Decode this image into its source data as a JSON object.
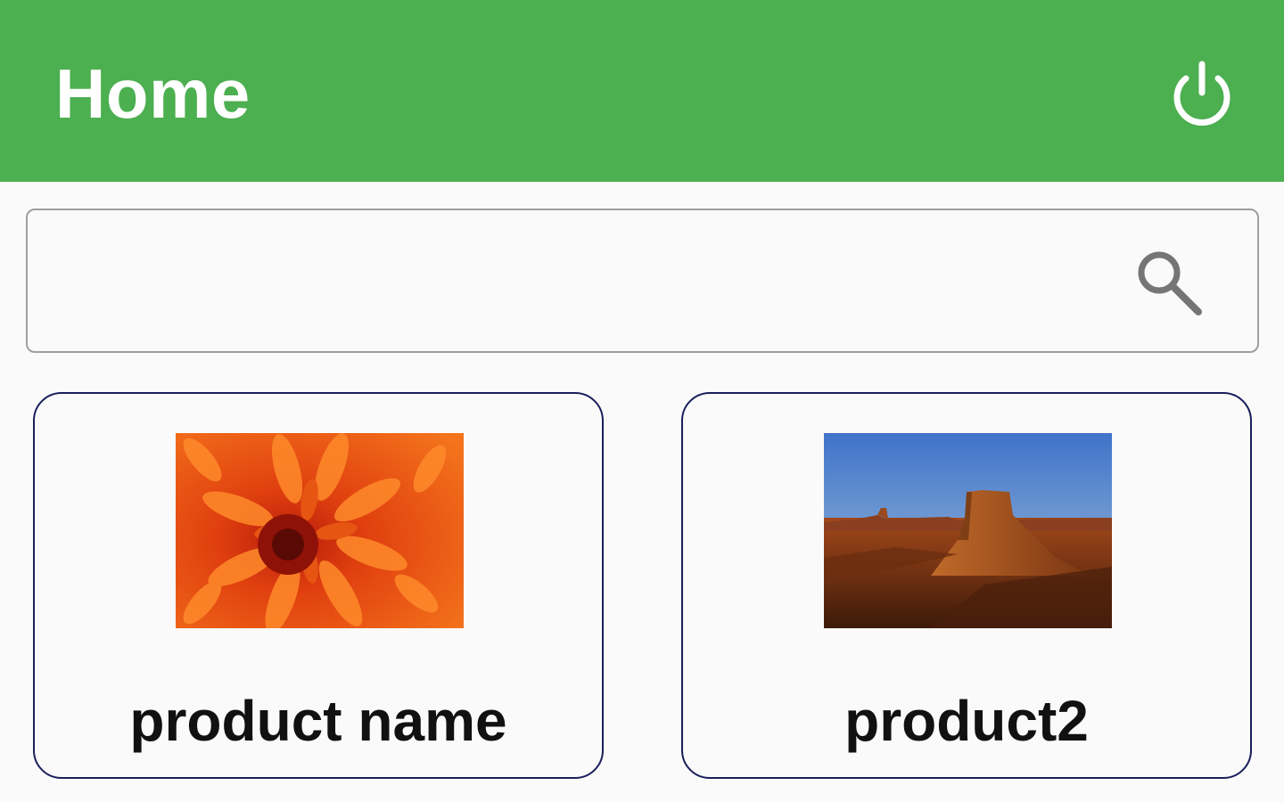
{
  "app_bar": {
    "title": "Home",
    "background_color": "#4caf50",
    "action_icon": "power-icon"
  },
  "search": {
    "value": "",
    "placeholder": "",
    "icon": "search-icon"
  },
  "products": [
    {
      "name": "product name",
      "image": "orange-chrysanthemum-photo"
    },
    {
      "name": "product2",
      "image": "desert-mesa-photo"
    }
  ]
}
